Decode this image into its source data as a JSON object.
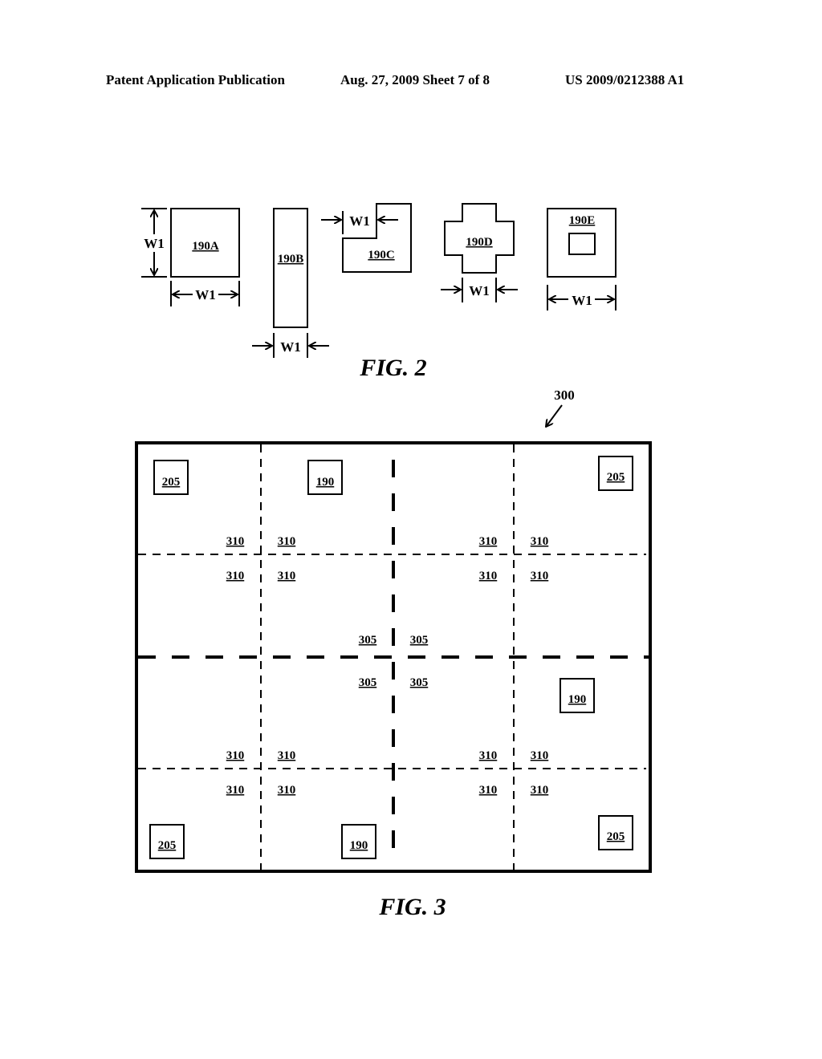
{
  "header": {
    "left": "Patent Application Publication",
    "middle": "Aug. 27, 2009  Sheet 7 of 8",
    "right": "US 2009/0212388 A1"
  },
  "fig2": {
    "caption": "FIG. 2",
    "dimension_label": "W1",
    "shapes": {
      "a": "190A",
      "b": "190B",
      "c": "190C",
      "d": "190D",
      "e": "190E"
    }
  },
  "fig3": {
    "caption": "FIG. 3",
    "reference": "300",
    "pads": [
      {
        "label": "205",
        "pos": "top-left"
      },
      {
        "label": "190",
        "pos": "top-second-column"
      },
      {
        "label": "205",
        "pos": "top-right"
      },
      {
        "label": "190",
        "pos": "lower-right"
      },
      {
        "label": "205",
        "pos": "bottom-left"
      },
      {
        "label": "190",
        "pos": "bottom-center"
      },
      {
        "label": "205",
        "pos": "bottom-right"
      }
    ],
    "fine_line_label": "310",
    "major_line_label": "305"
  }
}
